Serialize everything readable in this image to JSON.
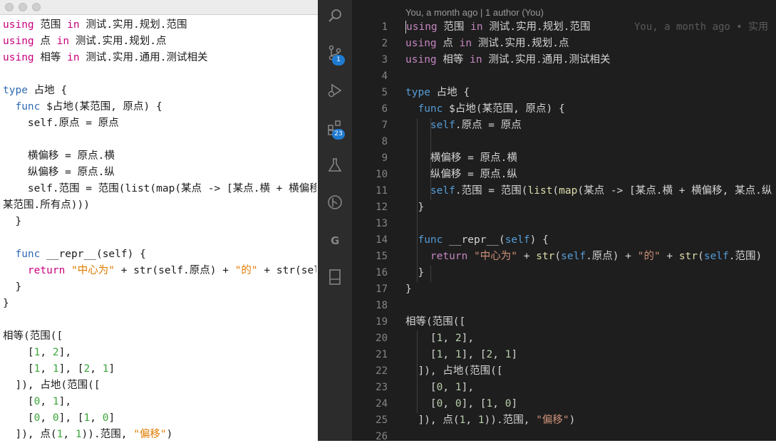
{
  "left_editor": {
    "lines": [
      [
        [
          "kw",
          "using"
        ],
        [
          "t",
          " 范围 "
        ],
        [
          "kw",
          "in"
        ],
        [
          "t",
          " 测试.实用.规划.范围"
        ]
      ],
      [
        [
          "kw",
          "using"
        ],
        [
          "t",
          " 点 "
        ],
        [
          "kw",
          "in"
        ],
        [
          "t",
          " 测试.实用.规划.点"
        ]
      ],
      [
        [
          "kw",
          "using"
        ],
        [
          "t",
          " 相等 "
        ],
        [
          "kw",
          "in"
        ],
        [
          "t",
          " 测试.实用.通用.测试相关"
        ]
      ],
      [],
      [
        [
          "kw2",
          "type"
        ],
        [
          "t",
          " 占地 {"
        ]
      ],
      [
        [
          "t",
          "  "
        ],
        [
          "kw2",
          "func"
        ],
        [
          "t",
          " $占地(某范围, 原点) {"
        ]
      ],
      [
        [
          "t",
          "    self.原点 = 原点"
        ]
      ],
      [],
      [
        [
          "t",
          "    横偏移 = 原点.横"
        ]
      ],
      [
        [
          "t",
          "    纵偏移 = 原点.纵"
        ]
      ],
      [
        [
          "t",
          "    self.范围 = 范围(list(map(某点 -> [某点.横 + 横偏移, 某点.纵 + 纵偏移],"
        ]
      ],
      [
        [
          "t",
          "某范围.所有点)))"
        ]
      ],
      [
        [
          "t",
          "  }"
        ]
      ],
      [],
      [
        [
          "t",
          "  "
        ],
        [
          "kw2",
          "func"
        ],
        [
          "t",
          " __repr__(self) {"
        ]
      ],
      [
        [
          "t",
          "    "
        ],
        [
          "kw",
          "return"
        ],
        [
          "t",
          " "
        ],
        [
          "lstr",
          "\"中心为\""
        ],
        [
          "t",
          " + str(self.原点) + "
        ],
        [
          "lstr",
          "\"的\""
        ],
        [
          "t",
          " + str(self.范围)"
        ]
      ],
      [
        [
          "t",
          "  }"
        ]
      ],
      [
        [
          "t",
          "}"
        ]
      ],
      [],
      [
        [
          "t",
          "相等(范围(["
        ]
      ],
      [
        [
          "t",
          "    ["
        ],
        [
          "lnum",
          "1"
        ],
        [
          "t",
          ", "
        ],
        [
          "lnum",
          "2"
        ],
        [
          "t",
          "],"
        ]
      ],
      [
        [
          "t",
          "    ["
        ],
        [
          "lnum",
          "1"
        ],
        [
          "t",
          ", "
        ],
        [
          "lnum",
          "1"
        ],
        [
          "t",
          "], ["
        ],
        [
          "lnum",
          "2"
        ],
        [
          "t",
          ", "
        ],
        [
          "lnum",
          "1"
        ],
        [
          "t",
          "]"
        ]
      ],
      [
        [
          "t",
          "  ]), 占地(范围(["
        ]
      ],
      [
        [
          "t",
          "    ["
        ],
        [
          "lnum",
          "0"
        ],
        [
          "t",
          ", "
        ],
        [
          "lnum",
          "1"
        ],
        [
          "t",
          "],"
        ]
      ],
      [
        [
          "t",
          "    ["
        ],
        [
          "lnum",
          "0"
        ],
        [
          "t",
          ", "
        ],
        [
          "lnum",
          "0"
        ],
        [
          "t",
          "], ["
        ],
        [
          "lnum",
          "1"
        ],
        [
          "t",
          ", "
        ],
        [
          "lnum",
          "0"
        ],
        [
          "t",
          "]"
        ]
      ],
      [
        [
          "t",
          "  ]), 点("
        ],
        [
          "lnum",
          "1"
        ],
        [
          "t",
          ", "
        ],
        [
          "lnum",
          "1"
        ],
        [
          "t",
          ")).范围, "
        ],
        [
          "lstr",
          "\"偏移\""
        ],
        [
          "t",
          ")"
        ]
      ]
    ]
  },
  "vscode": {
    "blame_header": "You, a month ago | 1 author (You)",
    "blame_inline": "You, a month ago • 实用",
    "badges": {
      "source_control": "1",
      "extensions": "23"
    },
    "line_numbers": [
      "1",
      "2",
      "3",
      "4",
      "5",
      "6",
      "7",
      "8",
      "9",
      "10",
      "11",
      "12",
      "13",
      "14",
      "15",
      "16",
      "17",
      "18",
      "19",
      "20",
      "21",
      "22",
      "23",
      "24",
      "25",
      "26"
    ],
    "lines": [
      [
        [
          "dk",
          "using"
        ],
        [
          "t",
          " 范围 "
        ],
        [
          "dk",
          "in"
        ],
        [
          "t",
          " 测试.实用.规划.范围"
        ]
      ],
      [
        [
          "dk",
          "using"
        ],
        [
          "t",
          " 点 "
        ],
        [
          "dk",
          "in"
        ],
        [
          "t",
          " 测试.实用.规划.点"
        ]
      ],
      [
        [
          "dk",
          "using"
        ],
        [
          "t",
          " 相等 "
        ],
        [
          "dk",
          "in"
        ],
        [
          "t",
          " 测试.实用.通用.测试相关"
        ]
      ],
      [],
      [
        [
          "dk2",
          "type"
        ],
        [
          "t",
          " 占地 {"
        ]
      ],
      [
        [
          "t",
          "  "
        ],
        [
          "dk2",
          "func"
        ],
        [
          "t",
          " $占地(某范围, 原点) {"
        ]
      ],
      [
        [
          "t",
          "    "
        ],
        [
          "dself",
          "self"
        ],
        [
          "t",
          ".原点 = 原点"
        ]
      ],
      [],
      [
        [
          "t",
          "    横偏移 = 原点.横"
        ]
      ],
      [
        [
          "t",
          "    纵偏移 = 原点.纵"
        ]
      ],
      [
        [
          "t",
          "    "
        ],
        [
          "dself",
          "self"
        ],
        [
          "t",
          ".范围 = 范围("
        ],
        [
          "dfn",
          "list"
        ],
        [
          "t",
          "("
        ],
        [
          "dfn",
          "map"
        ],
        [
          "t",
          "(某点 -> [某点.横 + 横偏移, 某点.纵 + 纵偏移], 某范围.所有点)))"
        ]
      ],
      [
        [
          "t",
          "  }"
        ]
      ],
      [],
      [
        [
          "t",
          "  "
        ],
        [
          "dk2",
          "func"
        ],
        [
          "t",
          " __repr__("
        ],
        [
          "dself",
          "self"
        ],
        [
          "t",
          ") {"
        ]
      ],
      [
        [
          "t",
          "    "
        ],
        [
          "dk",
          "return"
        ],
        [
          "t",
          " "
        ],
        [
          "dstr",
          "\"中心为\""
        ],
        [
          "t",
          " + "
        ],
        [
          "dfn",
          "str"
        ],
        [
          "t",
          "("
        ],
        [
          "dself",
          "self"
        ],
        [
          "t",
          ".原点) + "
        ],
        [
          "dstr",
          "\"的\""
        ],
        [
          "t",
          " + "
        ],
        [
          "dfn",
          "str"
        ],
        [
          "t",
          "("
        ],
        [
          "dself",
          "self"
        ],
        [
          "t",
          ".范围)"
        ]
      ],
      [
        [
          "t",
          "  }"
        ]
      ],
      [
        [
          "t",
          "}"
        ]
      ],
      [],
      [
        [
          "t",
          "相等(范围(["
        ]
      ],
      [
        [
          "t",
          "    ["
        ],
        [
          "dnum",
          "1"
        ],
        [
          "t",
          ", "
        ],
        [
          "dnum",
          "2"
        ],
        [
          "t",
          "],"
        ]
      ],
      [
        [
          "t",
          "    ["
        ],
        [
          "dnum",
          "1"
        ],
        [
          "t",
          ", "
        ],
        [
          "dnum",
          "1"
        ],
        [
          "t",
          "], ["
        ],
        [
          "dnum",
          "2"
        ],
        [
          "t",
          ", "
        ],
        [
          "dnum",
          "1"
        ],
        [
          "t",
          "]"
        ]
      ],
      [
        [
          "t",
          "  ]), 占地(范围(["
        ]
      ],
      [
        [
          "t",
          "    ["
        ],
        [
          "dnum",
          "0"
        ],
        [
          "t",
          ", "
        ],
        [
          "dnum",
          "1"
        ],
        [
          "t",
          "],"
        ]
      ],
      [
        [
          "t",
          "    ["
        ],
        [
          "dnum",
          "0"
        ],
        [
          "t",
          ", "
        ],
        [
          "dnum",
          "0"
        ],
        [
          "t",
          "], ["
        ],
        [
          "dnum",
          "1"
        ],
        [
          "t",
          ", "
        ],
        [
          "dnum",
          "0"
        ],
        [
          "t",
          "]"
        ]
      ],
      [
        [
          "t",
          "  ]), 点("
        ],
        [
          "dnum",
          "1"
        ],
        [
          "t",
          ", "
        ],
        [
          "dnum",
          "1"
        ],
        [
          "t",
          ")).范围, "
        ],
        [
          "dstr",
          "\"偏移\""
        ],
        [
          "t",
          ")"
        ]
      ],
      []
    ],
    "activity_icons": [
      "search-icon",
      "source-control-icon",
      "debug-icon",
      "extensions-icon",
      "test-flask-icon",
      "git-graph-icon",
      "gitlens-icon",
      "book-icon"
    ]
  }
}
